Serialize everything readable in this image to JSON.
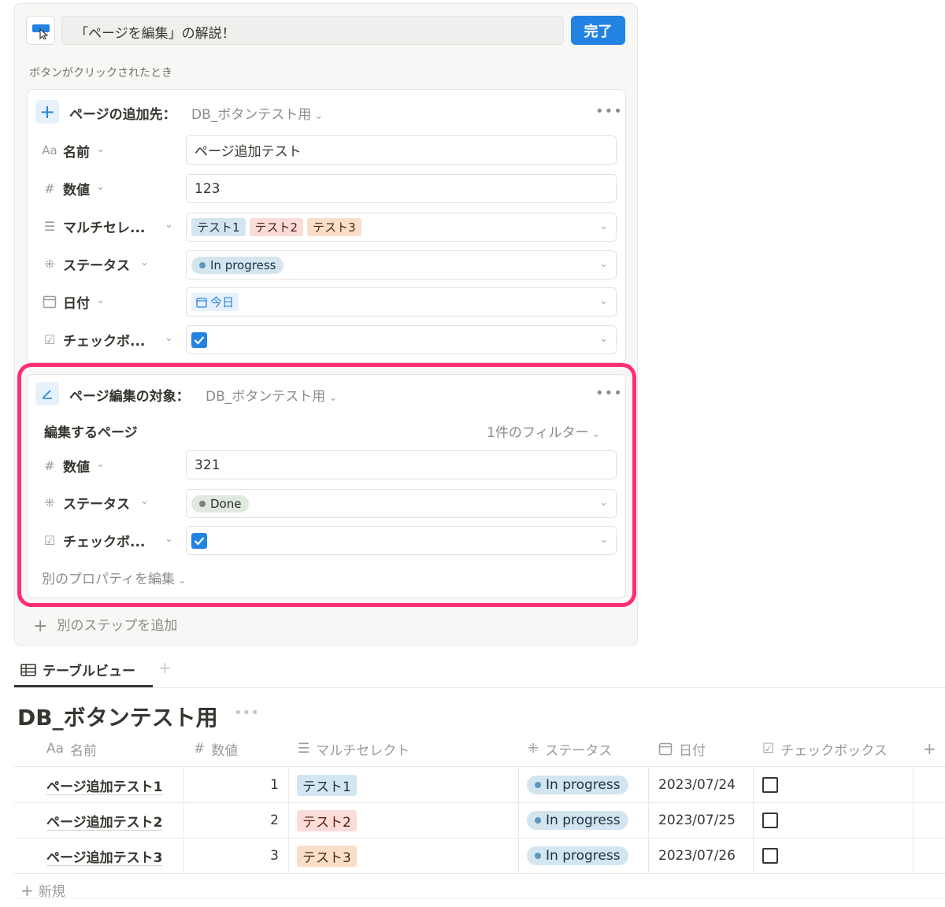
{
  "button_editor": {
    "button_name": "「ページを編集」の解説！",
    "done_label": "完了",
    "trigger_label": "ボタンがクリックされたとき",
    "add_page_step": {
      "title": "ページの追加先：",
      "database": "DB_ボタンテスト用",
      "props": [
        {
          "label": "名前",
          "icon": "Aa",
          "value": "ページ追加テスト"
        },
        {
          "label": "数値",
          "icon": "#",
          "value": "123"
        },
        {
          "label": "マルチセレ...",
          "icon": "list-icon",
          "tags": [
            "テスト1",
            "テスト2",
            "テスト3"
          ]
        },
        {
          "label": "ステータス",
          "icon": "status-icon",
          "status": "In progress"
        },
        {
          "label": "日付",
          "icon": "calendar-icon",
          "date": "今日"
        },
        {
          "label": "チェックボ...",
          "icon": "checkbox-icon",
          "checked": true
        }
      ]
    },
    "edit_page_step": {
      "title": "ページ編集の対象：",
      "database": "DB_ボタンテスト用",
      "target_label": "編集するページ",
      "filter_label": "1件のフィルター",
      "props": [
        {
          "label": "数値",
          "icon": "#",
          "value": "321"
        },
        {
          "label": "ステータス",
          "icon": "status-icon",
          "status": "Done"
        },
        {
          "label": "チェックボ...",
          "icon": "checkbox-icon",
          "checked": true
        }
      ],
      "other_prop_label": "別のプロパティを編集"
    },
    "add_step_label": "別のステップを追加"
  },
  "view": {
    "tab_label": "テーブルビュー",
    "db_title": "DB_ボタンテスト用"
  },
  "table": {
    "columns": [
      {
        "icon": "Aa",
        "label": "名前"
      },
      {
        "icon": "#",
        "label": "数値"
      },
      {
        "icon": "list-icon",
        "label": "マルチセレクト"
      },
      {
        "icon": "status-icon",
        "label": "ステータス"
      },
      {
        "icon": "calendar-icon",
        "label": "日付"
      },
      {
        "icon": "checkbox-icon",
        "label": "チェックボックス"
      }
    ],
    "rows": [
      {
        "name": "ページ追加テスト1",
        "num": "1",
        "tag": "テスト1",
        "status": "In progress",
        "date": "2023/07/24",
        "checked": false
      },
      {
        "name": "ページ追加テスト2",
        "num": "2",
        "tag": "テスト2",
        "status": "In progress",
        "date": "2023/07/25",
        "checked": false
      },
      {
        "name": "ページ追加テスト3",
        "num": "3",
        "tag": "テスト3",
        "status": "In progress",
        "date": "2023/07/26",
        "checked": false
      }
    ],
    "new_label": "新規"
  },
  "colors": {
    "accent": "#2383e2",
    "highlight": "#ff2e72"
  }
}
